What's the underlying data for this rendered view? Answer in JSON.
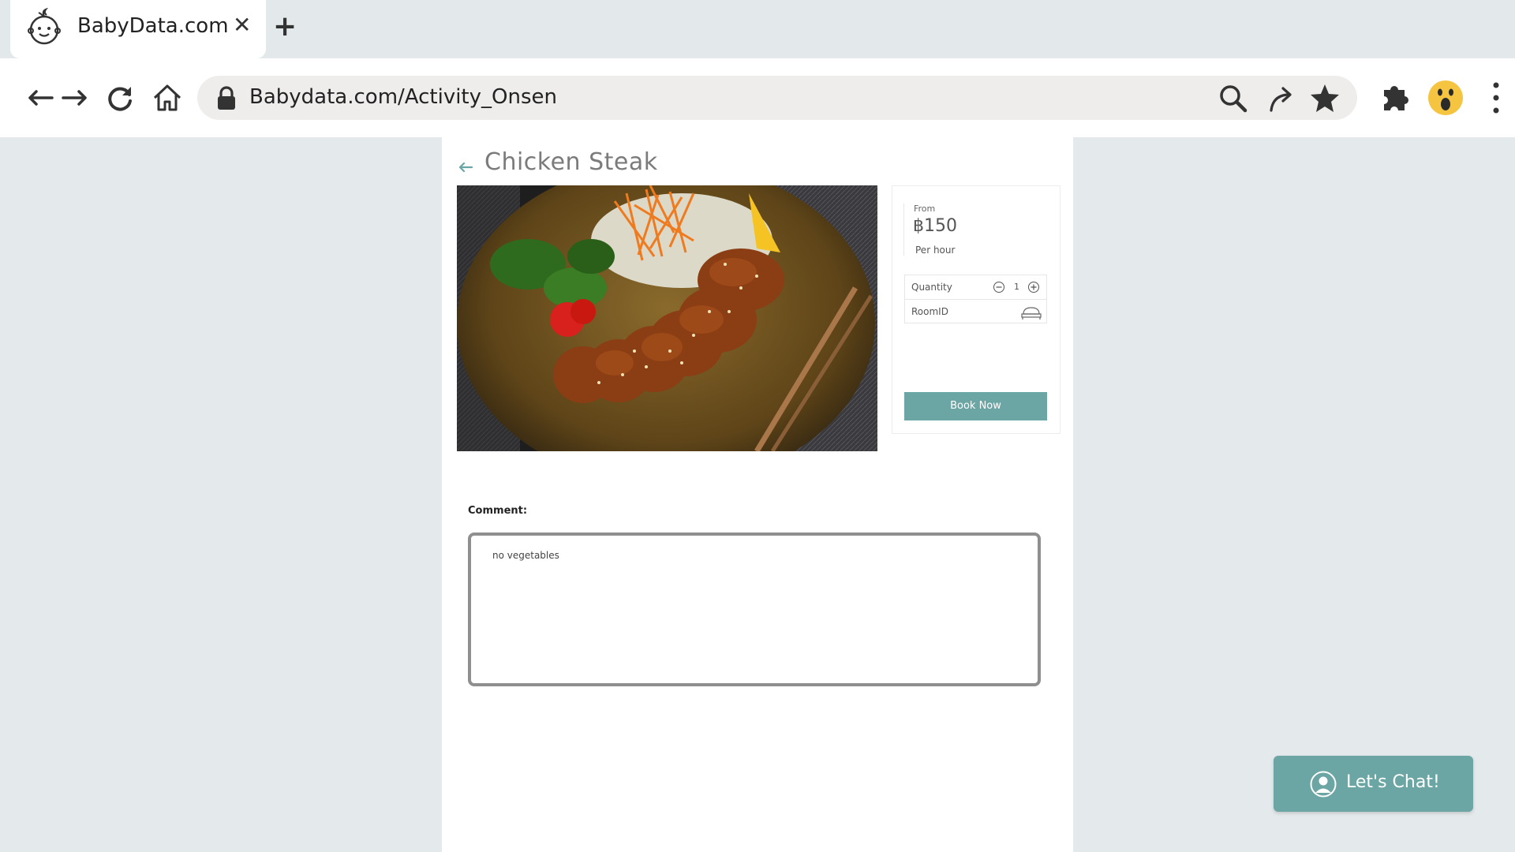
{
  "browser": {
    "tab_title": "BabyData.com",
    "tab_close": "✕",
    "new_tab": "+",
    "url": "Babydata.com/Activity_Onsen"
  },
  "page": {
    "title": "Chicken Steak",
    "image_alt": "Grilled chicken steak with sesame, salad, carrot and tomato"
  },
  "booking": {
    "from_label": "From",
    "price": "฿150",
    "per_label": "Per hour",
    "quantity_label": "Quantity",
    "quantity_value": "1",
    "room_label": "RoomID",
    "book_label": "Book Now"
  },
  "comment": {
    "label": "Comment:",
    "value": "no vegetables"
  },
  "chat": {
    "label": "Let's Chat!"
  },
  "colors": {
    "accent": "#6ba5a4",
    "page_bg": "#e4e9ec"
  }
}
